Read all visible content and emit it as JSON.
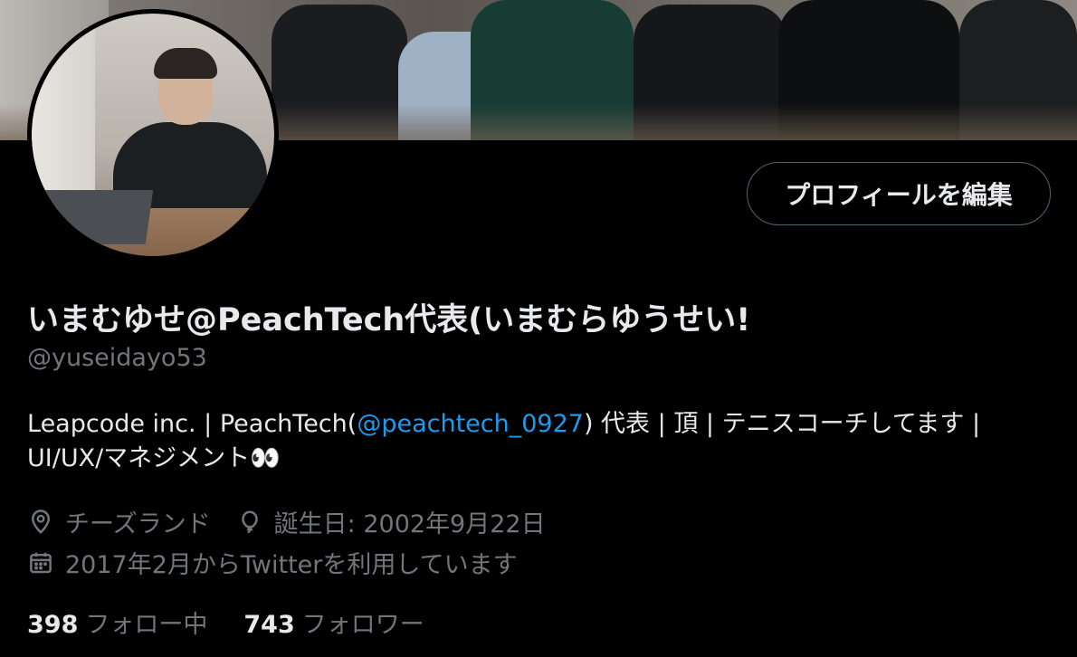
{
  "profile": {
    "edit_button": "プロフィールを編集",
    "name": "いまむゆせ@PeachTech代表(いまむらゆうせい!",
    "handle": "@yuseidayo53",
    "bio": {
      "part1": "Leapcode inc. | PeachTech(",
      "mention": "@peachtech_0927",
      "part2": ") 代表 | 頂 | テニスコーチしてます | UI/UX/マネジメント👀"
    },
    "location": "チーズランド",
    "birthday": "誕生日: 2002年9月22日",
    "joined": "2017年2月からTwitterを利用しています",
    "following_count": "398",
    "following_label": "フォロー中",
    "followers_count": "743",
    "followers_label": "フォロワー"
  },
  "icons": {
    "location": "location-pin-icon",
    "birthday": "balloon-icon",
    "joined": "calendar-icon"
  },
  "colors": {
    "background": "#000000",
    "text": "#e7e9ea",
    "secondary": "#71767b",
    "link": "#1d9bf0",
    "border": "#536471"
  }
}
